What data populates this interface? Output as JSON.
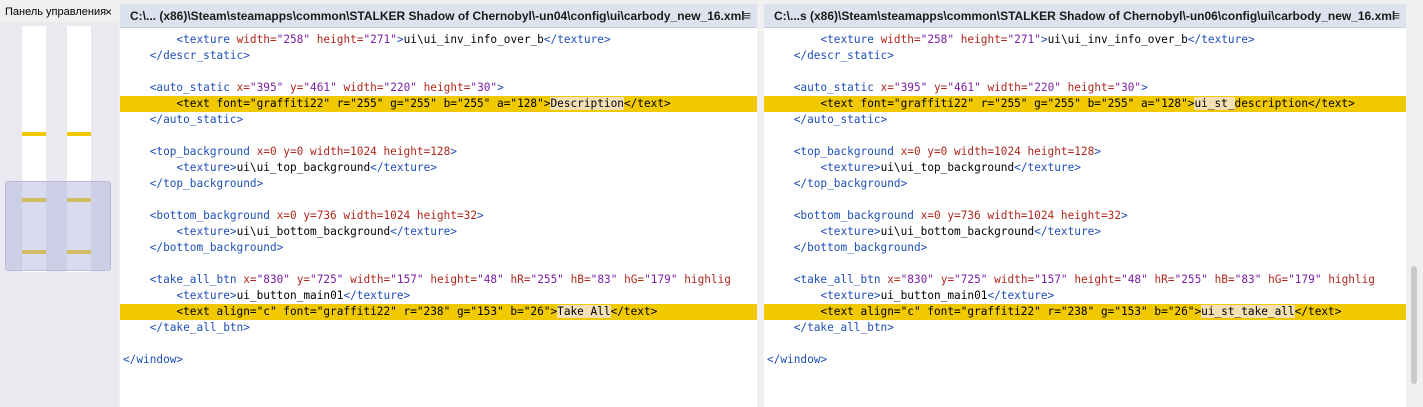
{
  "panel": {
    "title": "Панель управления",
    "close_icon": "×",
    "marks_col1": [
      0.43,
      0.7,
      0.91
    ],
    "marks_col2": [
      0.43,
      0.7,
      0.91
    ]
  },
  "panes": [
    {
      "tab_title": "C:\\... (x86)\\Steam\\steamapps\\common\\STALKER Shadow of Chernobyl\\-un04\\config\\ui\\carbody_new_16.xml",
      "menu_icon": "≡",
      "lines": [
        {
          "i": "        ",
          "p": [
            [
              "t",
              "<texture "
            ],
            [
              "a",
              "width="
            ],
            [
              "v",
              "\"258\""
            ],
            [
              "x",
              " "
            ],
            [
              "a",
              "height="
            ],
            [
              "v",
              "\"271\""
            ],
            [
              "t",
              ">"
            ],
            [
              "x",
              "ui\\ui_inv_info_over_b"
            ],
            [
              "t",
              "</texture>"
            ]
          ]
        },
        {
          "i": "    ",
          "p": [
            [
              "t",
              "</descr_static>"
            ]
          ]
        },
        {
          "i": "",
          "p": []
        },
        {
          "i": "    ",
          "p": [
            [
              "t",
              "<auto_static "
            ],
            [
              "a",
              "x="
            ],
            [
              "v",
              "\"395\""
            ],
            [
              "x",
              " "
            ],
            [
              "a",
              "y="
            ],
            [
              "v",
              "\"461\""
            ],
            [
              "x",
              " "
            ],
            [
              "a",
              "width="
            ],
            [
              "v",
              "\"220\""
            ],
            [
              "x",
              " "
            ],
            [
              "a",
              "height="
            ],
            [
              "v",
              "\"30\""
            ],
            [
              "t",
              ">"
            ]
          ]
        },
        {
          "hl": true,
          "i": "        ",
          "p": [
            [
              "x",
              "<text font=\"graffiti22\" r=\"255\" g=\"255\" b=\"255\" a=\"128\">"
            ],
            [
              "d",
              "Description"
            ],
            [
              "x",
              "</text>"
            ]
          ]
        },
        {
          "i": "    ",
          "p": [
            [
              "t",
              "</auto_static>"
            ]
          ]
        },
        {
          "i": "",
          "p": []
        },
        {
          "i": "    ",
          "p": [
            [
              "t",
              "<top_background "
            ],
            [
              "a",
              "x=0 y=0 width=1024 height=128"
            ],
            [
              "t",
              ">"
            ]
          ]
        },
        {
          "i": "        ",
          "p": [
            [
              "t",
              "<texture>"
            ],
            [
              "x",
              "ui\\ui_top_background"
            ],
            [
              "t",
              "</texture>"
            ]
          ]
        },
        {
          "i": "    ",
          "p": [
            [
              "t",
              "</top_background>"
            ]
          ]
        },
        {
          "i": "",
          "p": []
        },
        {
          "i": "    ",
          "p": [
            [
              "t",
              "<bottom_background "
            ],
            [
              "a",
              "x=0 y=736 width=1024 height=32"
            ],
            [
              "t",
              ">"
            ]
          ]
        },
        {
          "i": "        ",
          "p": [
            [
              "t",
              "<texture>"
            ],
            [
              "x",
              "ui\\ui_bottom_background"
            ],
            [
              "t",
              "</texture>"
            ]
          ]
        },
        {
          "i": "    ",
          "p": [
            [
              "t",
              "</bottom_background>"
            ]
          ]
        },
        {
          "i": "",
          "p": []
        },
        {
          "i": "    ",
          "p": [
            [
              "t",
              "<take_all_btn "
            ],
            [
              "a",
              "x="
            ],
            [
              "v",
              "\"830\""
            ],
            [
              "x",
              " "
            ],
            [
              "a",
              "y="
            ],
            [
              "v",
              "\"725\""
            ],
            [
              "x",
              " "
            ],
            [
              "a",
              "width="
            ],
            [
              "v",
              "\"157\""
            ],
            [
              "x",
              " "
            ],
            [
              "a",
              "height="
            ],
            [
              "v",
              "\"48\""
            ],
            [
              "x",
              " "
            ],
            [
              "a",
              "hR="
            ],
            [
              "v",
              "\"255\""
            ],
            [
              "x",
              " "
            ],
            [
              "a",
              "hB="
            ],
            [
              "v",
              "\"83\""
            ],
            [
              "x",
              " "
            ],
            [
              "a",
              "hG="
            ],
            [
              "v",
              "\"179\""
            ],
            [
              "x",
              " "
            ],
            [
              "a",
              "highlig"
            ]
          ]
        },
        {
          "i": "        ",
          "p": [
            [
              "t",
              "<texture>"
            ],
            [
              "x",
              "ui_button_main01"
            ],
            [
              "t",
              "</texture>"
            ]
          ]
        },
        {
          "hl": true,
          "i": "        ",
          "p": [
            [
              "x",
              "<text align=\"c\" font=\"graffiti22\" r=\"238\" g=\"153\" b=\"26\">"
            ],
            [
              "d",
              "Take All"
            ],
            [
              "x",
              "</text>"
            ]
          ]
        },
        {
          "i": "    ",
          "p": [
            [
              "t",
              "</take_all_btn>"
            ]
          ]
        },
        {
          "i": "",
          "p": []
        },
        {
          "i": "",
          "p": [
            [
              "t",
              "</window>"
            ]
          ]
        }
      ]
    },
    {
      "tab_title": "C:\\...s (x86)\\Steam\\steamapps\\common\\STALKER Shadow of Chernobyl\\-un06\\config\\ui\\carbody_new_16.xml",
      "menu_icon": "≡",
      "lines": [
        {
          "i": "        ",
          "p": [
            [
              "t",
              "<texture "
            ],
            [
              "a",
              "width="
            ],
            [
              "v",
              "\"258\""
            ],
            [
              "x",
              " "
            ],
            [
              "a",
              "height="
            ],
            [
              "v",
              "\"271\""
            ],
            [
              "t",
              ">"
            ],
            [
              "x",
              "ui\\ui_inv_info_over_b"
            ],
            [
              "t",
              "</texture>"
            ]
          ]
        },
        {
          "i": "    ",
          "p": [
            [
              "t",
              "</descr_static>"
            ]
          ]
        },
        {
          "i": "",
          "p": []
        },
        {
          "i": "    ",
          "p": [
            [
              "t",
              "<auto_static "
            ],
            [
              "a",
              "x="
            ],
            [
              "v",
              "\"395\""
            ],
            [
              "x",
              " "
            ],
            [
              "a",
              "y="
            ],
            [
              "v",
              "\"461\""
            ],
            [
              "x",
              " "
            ],
            [
              "a",
              "width="
            ],
            [
              "v",
              "\"220\""
            ],
            [
              "x",
              " "
            ],
            [
              "a",
              "height="
            ],
            [
              "v",
              "\"30\""
            ],
            [
              "t",
              ">"
            ]
          ]
        },
        {
          "hl": true,
          "i": "        ",
          "p": [
            [
              "x",
              "<text font=\"graffiti22\" r=\"255\" g=\"255\" b=\"255\" a=\"128\">"
            ],
            [
              "d",
              "ui_st_"
            ],
            [
              "x",
              "description"
            ],
            [
              "x",
              "</text>"
            ]
          ]
        },
        {
          "i": "    ",
          "p": [
            [
              "t",
              "</auto_static>"
            ]
          ]
        },
        {
          "i": "",
          "p": []
        },
        {
          "i": "    ",
          "p": [
            [
              "t",
              "<top_background "
            ],
            [
              "a",
              "x=0 y=0 width=1024 height=128"
            ],
            [
              "t",
              ">"
            ]
          ]
        },
        {
          "i": "        ",
          "p": [
            [
              "t",
              "<texture>"
            ],
            [
              "x",
              "ui\\ui_top_background"
            ],
            [
              "t",
              "</texture>"
            ]
          ]
        },
        {
          "i": "    ",
          "p": [
            [
              "t",
              "</top_background>"
            ]
          ]
        },
        {
          "i": "",
          "p": []
        },
        {
          "i": "    ",
          "p": [
            [
              "t",
              "<bottom_background "
            ],
            [
              "a",
              "x=0 y=736 width=1024 height=32"
            ],
            [
              "t",
              ">"
            ]
          ]
        },
        {
          "i": "        ",
          "p": [
            [
              "t",
              "<texture>"
            ],
            [
              "x",
              "ui\\ui_bottom_background"
            ],
            [
              "t",
              "</texture>"
            ]
          ]
        },
        {
          "i": "    ",
          "p": [
            [
              "t",
              "</bottom_background>"
            ]
          ]
        },
        {
          "i": "",
          "p": []
        },
        {
          "i": "    ",
          "p": [
            [
              "t",
              "<take_all_btn "
            ],
            [
              "a",
              "x="
            ],
            [
              "v",
              "\"830\""
            ],
            [
              "x",
              " "
            ],
            [
              "a",
              "y="
            ],
            [
              "v",
              "\"725\""
            ],
            [
              "x",
              " "
            ],
            [
              "a",
              "width="
            ],
            [
              "v",
              "\"157\""
            ],
            [
              "x",
              " "
            ],
            [
              "a",
              "height="
            ],
            [
              "v",
              "\"48\""
            ],
            [
              "x",
              " "
            ],
            [
              "a",
              "hR="
            ],
            [
              "v",
              "\"255\""
            ],
            [
              "x",
              " "
            ],
            [
              "a",
              "hB="
            ],
            [
              "v",
              "\"83\""
            ],
            [
              "x",
              " "
            ],
            [
              "a",
              "hG="
            ],
            [
              "v",
              "\"179\""
            ],
            [
              "x",
              " "
            ],
            [
              "a",
              "highlig"
            ]
          ]
        },
        {
          "i": "        ",
          "p": [
            [
              "t",
              "<texture>"
            ],
            [
              "x",
              "ui_button_main01"
            ],
            [
              "t",
              "</texture>"
            ]
          ]
        },
        {
          "hl": true,
          "i": "        ",
          "p": [
            [
              "x",
              "<text align=\"c\" font=\"graffiti22\" r=\"238\" g=\"153\" b=\"26\">"
            ],
            [
              "d",
              "ui_st_take_all"
            ],
            [
              "x",
              "</text>"
            ]
          ]
        },
        {
          "i": "    ",
          "p": [
            [
              "t",
              "</take_all_btn>"
            ]
          ]
        },
        {
          "i": "",
          "p": []
        },
        {
          "i": "",
          "p": [
            [
              "t",
              "</window>"
            ]
          ]
        }
      ]
    }
  ],
  "colors": {
    "tag": "#1f4fb6",
    "attr": "#b0281d",
    "value": "#7a1fa3",
    "diff_line": "#f1c900",
    "diff_word": "#f3e1b5"
  },
  "scrollbar": {
    "position_fraction": 0.62
  }
}
